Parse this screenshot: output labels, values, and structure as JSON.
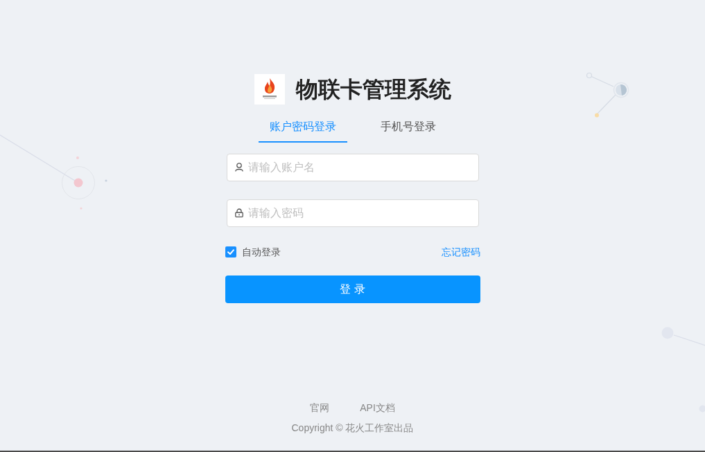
{
  "header": {
    "title": "物联卡管理系统"
  },
  "tabs": [
    {
      "label": "账户密码登录",
      "selected": true
    },
    {
      "label": "手机号登录",
      "selected": false
    }
  ],
  "fields": [
    {
      "kind": "username",
      "placeholder": "请输入账户名"
    },
    {
      "kind": "password",
      "placeholder": "请输入密码"
    }
  ],
  "auto_login": {
    "label": "自动登录",
    "checked": true
  },
  "forgot_password": "忘记密码",
  "submit_button": "登 录",
  "footer": {
    "links": [
      "官网",
      "API文档"
    ],
    "copyright": "Copyright © 花火工作室出品"
  }
}
